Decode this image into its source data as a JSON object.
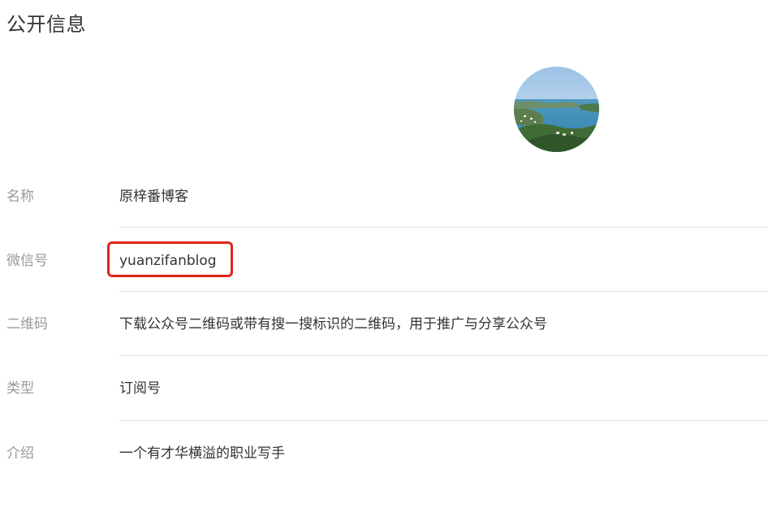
{
  "header": {
    "title": "公开信息"
  },
  "avatar": {
    "description_icon": "landscape-photo"
  },
  "fields": [
    {
      "label": "名称",
      "value": "原梓番博客"
    },
    {
      "label": "微信号",
      "value": "yuanzifanblog"
    },
    {
      "label": "二维码",
      "value": "下载公众号二维码或带有搜一搜标识的二维码，用于推广与分享公众号"
    },
    {
      "label": "类型",
      "value": "订阅号"
    },
    {
      "label": "介绍",
      "value": "一个有才华横溢的职业写手"
    }
  ],
  "colors": {
    "label": "#9a9a9a",
    "value": "#333333",
    "divider": "#e6e6e6",
    "highlight": "#e0261c"
  }
}
